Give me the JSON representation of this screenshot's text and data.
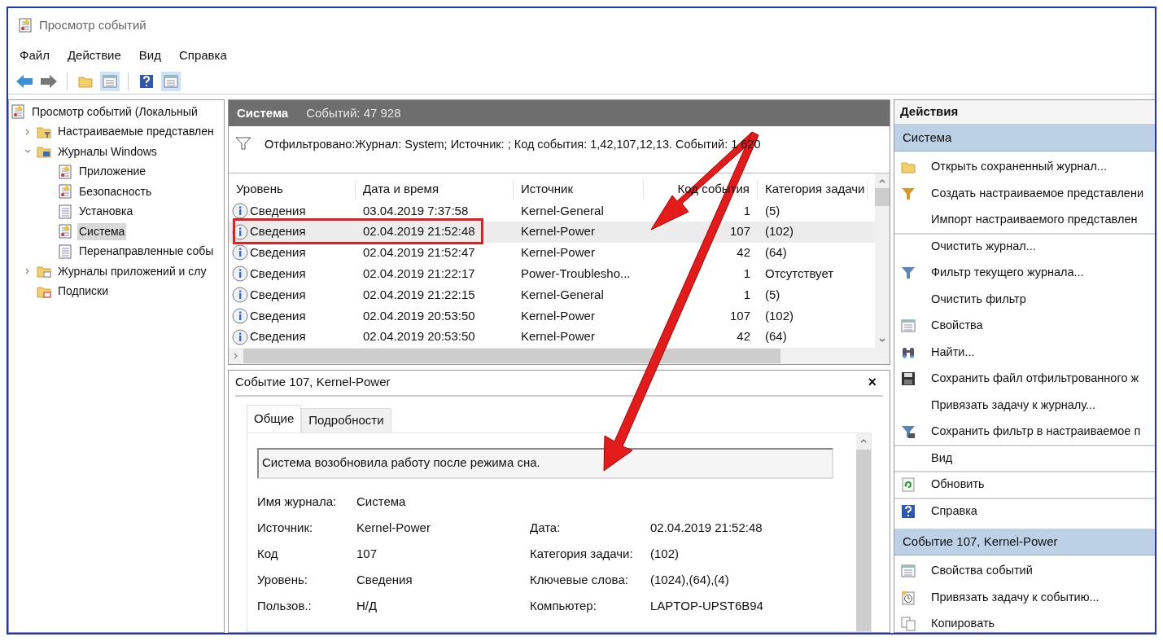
{
  "window": {
    "title": "Просмотр событий"
  },
  "menu": [
    "Файл",
    "Действие",
    "Вид",
    "Справка"
  ],
  "tree": [
    {
      "label": "Просмотр событий (Локальный",
      "kind": "viewer",
      "selected": false,
      "children": [
        {
          "label": "Настраиваемые представлен",
          "kind": "folder-filter",
          "expanded": false,
          "selected": false
        },
        {
          "label": "Журналы Windows",
          "kind": "folder-pc",
          "expanded": true,
          "selected": false,
          "children": [
            {
              "label": "Приложение",
              "kind": "log-warn",
              "selected": false
            },
            {
              "label": "Безопасность",
              "kind": "log-warn",
              "selected": false
            },
            {
              "label": "Установка",
              "kind": "log",
              "selected": false
            },
            {
              "label": "Система",
              "kind": "log-warn",
              "selected": true
            },
            {
              "label": "Перенаправленные собы",
              "kind": "log",
              "selected": false
            }
          ]
        },
        {
          "label": "Журналы приложений и слу",
          "kind": "folder-log",
          "expanded": false,
          "selected": false
        },
        {
          "label": "Подписки",
          "kind": "folder-sub",
          "selected": false
        }
      ]
    }
  ],
  "log_header": {
    "title": "Система",
    "count": "Событий: 47 928"
  },
  "filter": "Отфильтровано:Журнал: System; Источник: ; Код события: 1,42,107,12,13. Событий: 1 620",
  "table": {
    "columns": [
      "Уровень",
      "Дата и время",
      "Источник",
      "Код события",
      "Категория задачи"
    ],
    "rows": [
      {
        "level": "Сведения",
        "date": "03.04.2019 7:37:58",
        "source": "Kernel-General",
        "code": "1",
        "category": "(5)",
        "selected": false
      },
      {
        "level": "Сведения",
        "date": "02.04.2019 21:52:48",
        "source": "Kernel-Power",
        "code": "107",
        "category": "(102)",
        "selected": true
      },
      {
        "level": "Сведения",
        "date": "02.04.2019 21:52:47",
        "source": "Kernel-Power",
        "code": "42",
        "category": "(64)",
        "selected": false
      },
      {
        "level": "Сведения",
        "date": "02.04.2019 21:22:17",
        "source": "Power-Troublesho...",
        "code": "1",
        "category": "Отсутствует",
        "selected": false
      },
      {
        "level": "Сведения",
        "date": "02.04.2019 21:22:15",
        "source": "Kernel-General",
        "code": "1",
        "category": "(5)",
        "selected": false
      },
      {
        "level": "Сведения",
        "date": "02.04.2019 20:53:50",
        "source": "Kernel-Power",
        "code": "107",
        "category": "(102)",
        "selected": false
      },
      {
        "level": "Сведения",
        "date": "02.04.2019 20:53:50",
        "source": "Kernel-Power",
        "code": "42",
        "category": "(64)",
        "selected": false
      }
    ]
  },
  "detail": {
    "title": "Событие 107, Kernel-Power",
    "close": "×",
    "tabs": [
      {
        "label": "Общие",
        "selected": true
      },
      {
        "label": "Подробности",
        "selected": false
      }
    ],
    "message": "Система возобновила работу после режима сна.",
    "rows": [
      [
        {
          "label": "Имя журнала:",
          "value": "Система"
        }
      ],
      [
        {
          "label": "Источник:",
          "value": "Kernel-Power"
        },
        {
          "label": "Дата:",
          "value": "02.04.2019 21:52:48"
        }
      ],
      [
        {
          "label": "Код",
          "value": "107"
        },
        {
          "label": "Категория задачи:",
          "value": "(102)"
        }
      ],
      [
        {
          "label": "Уровень:",
          "value": "Сведения"
        },
        {
          "label": "Ключевые слова:",
          "value": "(1024),(64),(4)"
        }
      ],
      [
        {
          "label": "Пользов.:",
          "value": "Н/Д"
        },
        {
          "label": "Компьютер:",
          "value": "LAPTOP-UPST6B94"
        }
      ]
    ]
  },
  "actions": {
    "title": "Действия",
    "sections": [
      {
        "title": "Система",
        "items": [
          {
            "label": "Открыть сохраненный журнал...",
            "kind": "folder",
            "divider": false
          },
          {
            "label": "Создать настраиваемое представлени",
            "kind": "funnel-star",
            "divider": false
          },
          {
            "label": "Импорт настраиваемого представлен",
            "kind": "text",
            "divider": true
          },
          {
            "label": "Очистить журнал...",
            "kind": "text",
            "divider": false
          },
          {
            "label": "Фильтр текущего журнала...",
            "kind": "funnel",
            "divider": false
          },
          {
            "label": "Очистить фильтр",
            "kind": "text",
            "divider": false
          },
          {
            "label": "Свойства",
            "kind": "props",
            "divider": false
          },
          {
            "label": "Найти...",
            "kind": "binoculars",
            "divider": false
          },
          {
            "label": "Сохранить файл отфильтрованного ж",
            "kind": "disk",
            "divider": false
          },
          {
            "label": "Привязать задачу к журналу...",
            "kind": "text",
            "divider": false
          },
          {
            "label": "Сохранить фильтр в настраиваемое п",
            "kind": "funnel-save",
            "divider": true
          },
          {
            "label": "Вид",
            "kind": "text",
            "divider": true
          },
          {
            "label": "Обновить",
            "kind": "refresh",
            "divider": true
          },
          {
            "label": "Справка",
            "kind": "help",
            "divider": false
          }
        ]
      },
      {
        "title": "Событие 107, Kernel-Power",
        "items": [
          {
            "label": "Свойства событий",
            "kind": "props",
            "divider": false
          },
          {
            "label": "Привязать задачу к событию...",
            "kind": "clock",
            "divider": false
          },
          {
            "label": "Копировать",
            "kind": "copy"
          }
        ]
      }
    ]
  }
}
